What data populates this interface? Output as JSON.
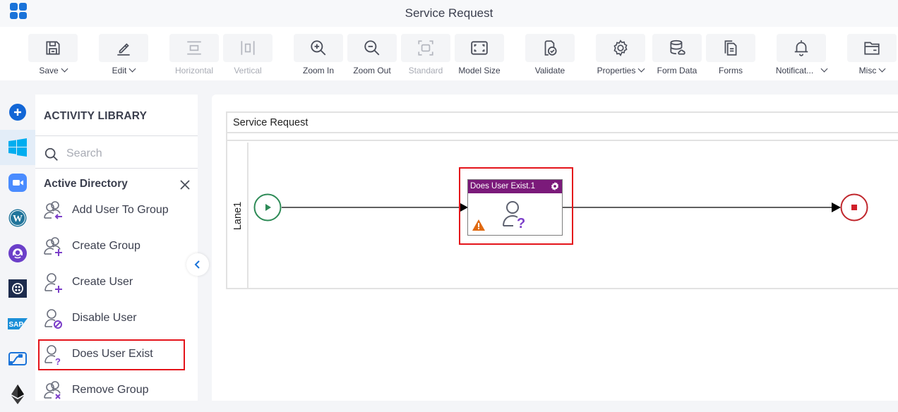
{
  "app": {
    "title": "Service Request",
    "grid_icon": "app-grid-icon"
  },
  "toolbar": {
    "items": [
      {
        "label": "Save",
        "icon": "save-icon",
        "dropdown": true,
        "enabled": true
      },
      {
        "label": "Edit",
        "icon": "pencil-icon",
        "dropdown": true,
        "enabled": true
      },
      {
        "label": "Horizontal",
        "icon": "horizontal-layout-icon",
        "dropdown": false,
        "enabled": false
      },
      {
        "label": "Vertical",
        "icon": "vertical-layout-icon",
        "dropdown": false,
        "enabled": false
      },
      {
        "label": "Zoom In",
        "icon": "zoom-in-icon",
        "dropdown": false,
        "enabled": true
      },
      {
        "label": "Zoom Out",
        "icon": "zoom-out-icon",
        "dropdown": false,
        "enabled": true
      },
      {
        "label": "Standard",
        "icon": "standard-size-icon",
        "dropdown": false,
        "enabled": false
      },
      {
        "label": "Model Size",
        "icon": "model-size-icon",
        "dropdown": false,
        "enabled": true
      },
      {
        "label": "Validate",
        "icon": "validate-icon",
        "dropdown": false,
        "enabled": true
      },
      {
        "label": "Properties",
        "icon": "gear-icon",
        "dropdown": true,
        "enabled": true
      },
      {
        "label": "Form Data",
        "icon": "database-icon",
        "dropdown": false,
        "enabled": true
      },
      {
        "label": "Forms",
        "icon": "forms-icon",
        "dropdown": false,
        "enabled": true
      },
      {
        "label": "Notificat...",
        "icon": "bell-icon",
        "dropdown": true,
        "enabled": true
      },
      {
        "label": "Misc",
        "icon": "folder-icon",
        "dropdown": true,
        "enabled": true
      }
    ]
  },
  "rail": {
    "items": [
      {
        "name": "add",
        "icon": "add-circle-icon",
        "active": false
      },
      {
        "name": "windows",
        "icon": "windows-icon",
        "active": true
      },
      {
        "name": "zoom",
        "icon": "zoom-video-icon",
        "active": false
      },
      {
        "name": "wordpress",
        "icon": "wordpress-icon",
        "active": false
      },
      {
        "name": "support",
        "icon": "headset-icon",
        "active": false
      },
      {
        "name": "twilio",
        "icon": "twilio-icon",
        "active": false
      },
      {
        "name": "sap",
        "icon": "sap-icon",
        "active": false
      },
      {
        "name": "power-automate",
        "icon": "power-automate-icon",
        "active": false
      },
      {
        "name": "ethereum",
        "icon": "ethereum-icon",
        "active": false
      }
    ]
  },
  "library": {
    "title": "ACTIVITY LIBRARY",
    "search_placeholder": "Search",
    "search_value": "",
    "section": "Active Directory",
    "items": [
      {
        "label": "Add User To Group",
        "icon": "add-user-to-group-icon",
        "selected": false
      },
      {
        "label": "Create Group",
        "icon": "create-group-icon",
        "selected": false
      },
      {
        "label": "Create User",
        "icon": "create-user-icon",
        "selected": false
      },
      {
        "label": "Disable User",
        "icon": "disable-user-icon",
        "selected": false
      },
      {
        "label": "Does User Exist",
        "icon": "does-user-exist-icon",
        "selected": true
      },
      {
        "label": "Remove Group",
        "icon": "remove-group-icon",
        "selected": false
      }
    ]
  },
  "canvas": {
    "pool_title": "Service Request",
    "lane_label": "Lane1",
    "task": {
      "name": "Does User Exist.1",
      "warning": true
    },
    "colors": {
      "task_header": "#7b1a7a",
      "start": "#2e8b57",
      "end": "#c0272d",
      "selection": "#e4141b"
    }
  }
}
